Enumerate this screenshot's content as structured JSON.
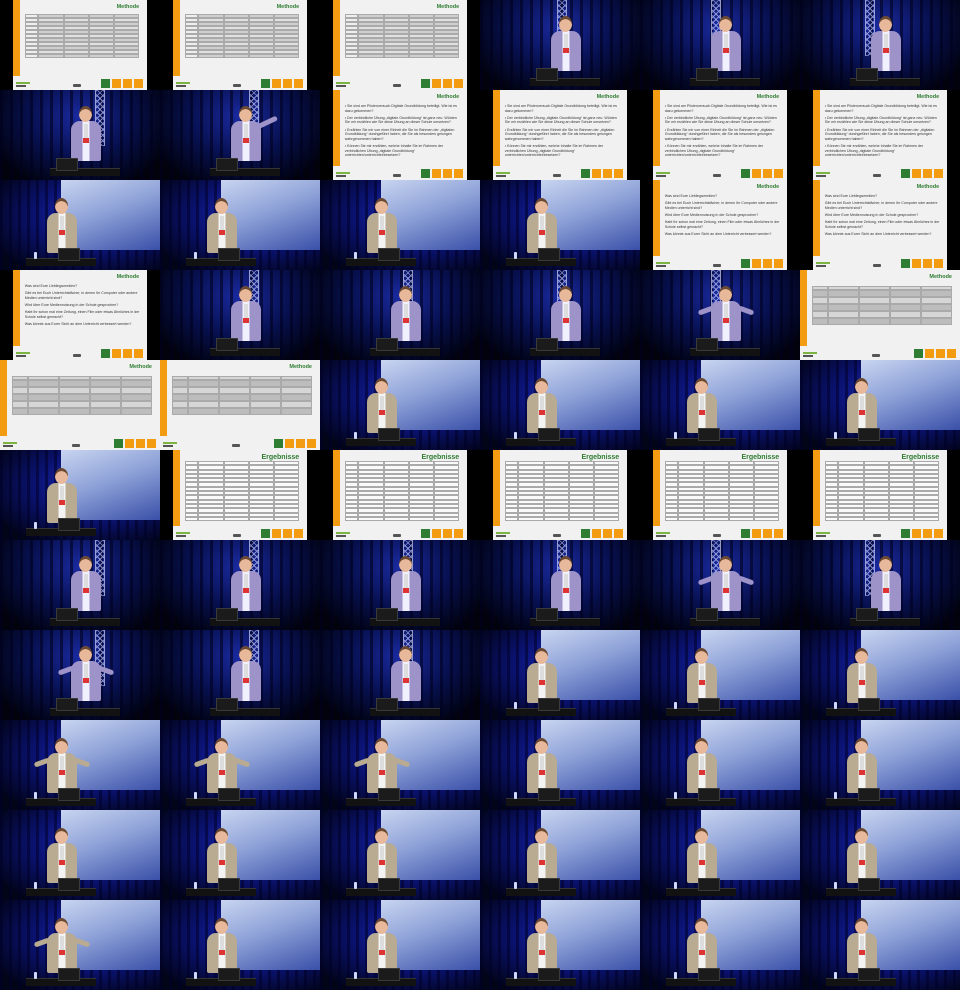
{
  "grid": {
    "columns": 6,
    "rows": 11
  },
  "slide_texts": {
    "methode_title": "Methode",
    "ergebnisse_title": "Ergebnisse",
    "methode_questions_a": [
      "Sie sind am Pilotenversuch Digitale Grundbildung beteiligt. Wie ist es dazu gekommen?",
      "Der verbindliche Übung „digitale Grundbildung“ ist ganz neu. Würden Sie mir erzählen wie Sie diese Übung an dieser Schule umsetzen?",
      "Erzählen Sie mir von einer Einheit die Sie im Rahmen der „digitalen Grundbildung“ durchgeführt haben, die Sie als besonders gelungen wahrgenommen haben?",
      "Können Sie mir erzählen, welche Inhalte Sie im Rahmen der verbindlichen Übung „digitale Grundbildung“ unterrichten/unterrichtet/besetzen?"
    ],
    "methode_questions_b": [
      "Was sind Eure Lieblingsmedien?",
      "Gibt es bei Euch Unterrichtsfächer, in denen Ihr Computer oder andere Medien unterricht sind?",
      "Wird über Eure Mediennutzung in der Schule gesprochen?",
      "Habt Ihr schon mal eine Zeitung, einen Film oder etwas Ähnliches in der Schule selbst gemacht?",
      "Was könnte aus Eurer Sicht an dem Unterricht verbessert werden?"
    ]
  },
  "cells": [
    {
      "kind": "table",
      "title": "Methode"
    },
    {
      "kind": "table",
      "title": "Methode"
    },
    {
      "kind": "table",
      "title": "Methode"
    },
    {
      "kind": "stage",
      "speaker": "lilac"
    },
    {
      "kind": "stage",
      "speaker": "lilac"
    },
    {
      "kind": "stage",
      "speaker": "lilac"
    },
    {
      "kind": "stage",
      "speaker": "lilac"
    },
    {
      "kind": "stage",
      "speaker": "lilac",
      "pose": "point"
    },
    {
      "kind": "questions_a",
      "title": "Methode"
    },
    {
      "kind": "questions_a",
      "title": "Methode"
    },
    {
      "kind": "questions_a",
      "title": "Methode"
    },
    {
      "kind": "questions_a",
      "title": "Methode"
    },
    {
      "kind": "screen",
      "speaker": "beige"
    },
    {
      "kind": "screen",
      "speaker": "beige"
    },
    {
      "kind": "screen",
      "speaker": "beige"
    },
    {
      "kind": "screen",
      "speaker": "beige"
    },
    {
      "kind": "questions_b",
      "title": "Methode"
    },
    {
      "kind": "questions_b",
      "title": "Methode"
    },
    {
      "kind": "questions_b",
      "title": "Methode"
    },
    {
      "kind": "stage",
      "speaker": "lilac"
    },
    {
      "kind": "stage",
      "speaker": "lilac"
    },
    {
      "kind": "stage",
      "speaker": "lilac"
    },
    {
      "kind": "stage",
      "speaker": "lilac",
      "pose": "gesture"
    },
    {
      "kind": "grey_table",
      "title": "Methode"
    },
    {
      "kind": "grey_table",
      "title": "Methode"
    },
    {
      "kind": "grey_table",
      "title": "Methode"
    },
    {
      "kind": "screen",
      "speaker": "beige"
    },
    {
      "kind": "screen",
      "speaker": "beige"
    },
    {
      "kind": "screen",
      "speaker": "beige"
    },
    {
      "kind": "screen",
      "speaker": "beige"
    },
    {
      "kind": "screen",
      "speaker": "beige"
    },
    {
      "kind": "results",
      "title": "Ergebnisse"
    },
    {
      "kind": "results",
      "title": "Ergebnisse"
    },
    {
      "kind": "results",
      "title": "Ergebnisse"
    },
    {
      "kind": "results",
      "title": "Ergebnisse"
    },
    {
      "kind": "results",
      "title": "Ergebnisse"
    },
    {
      "kind": "stage",
      "speaker": "lilac"
    },
    {
      "kind": "stage",
      "speaker": "lilac"
    },
    {
      "kind": "stage",
      "speaker": "lilac"
    },
    {
      "kind": "stage",
      "speaker": "lilac"
    },
    {
      "kind": "stage",
      "speaker": "lilac",
      "pose": "gesture"
    },
    {
      "kind": "stage",
      "speaker": "lilac"
    },
    {
      "kind": "stage",
      "speaker": "lilac",
      "pose": "gesture"
    },
    {
      "kind": "stage",
      "speaker": "lilac"
    },
    {
      "kind": "stage",
      "speaker": "lilac"
    },
    {
      "kind": "screen",
      "speaker": "beige"
    },
    {
      "kind": "screen",
      "speaker": "beige"
    },
    {
      "kind": "screen",
      "speaker": "beige"
    },
    {
      "kind": "screen",
      "speaker": "beige",
      "pose": "gesture"
    },
    {
      "kind": "screen",
      "speaker": "beige",
      "pose": "gesture"
    },
    {
      "kind": "screen",
      "speaker": "beige",
      "pose": "gesture"
    },
    {
      "kind": "screen",
      "speaker": "beige"
    },
    {
      "kind": "screen",
      "speaker": "beige"
    },
    {
      "kind": "screen",
      "speaker": "beige"
    },
    {
      "kind": "screen",
      "speaker": "beige"
    },
    {
      "kind": "screen",
      "speaker": "beige"
    },
    {
      "kind": "screen",
      "speaker": "beige"
    },
    {
      "kind": "screen",
      "speaker": "beige"
    },
    {
      "kind": "screen",
      "speaker": "beige"
    },
    {
      "kind": "screen",
      "speaker": "beige"
    },
    {
      "kind": "screen",
      "speaker": "beige",
      "pose": "gesture"
    },
    {
      "kind": "screen",
      "speaker": "beige"
    },
    {
      "kind": "screen",
      "speaker": "beige"
    },
    {
      "kind": "screen",
      "speaker": "beige"
    },
    {
      "kind": "screen",
      "speaker": "beige"
    },
    {
      "kind": "screen",
      "speaker": "beige"
    }
  ]
}
